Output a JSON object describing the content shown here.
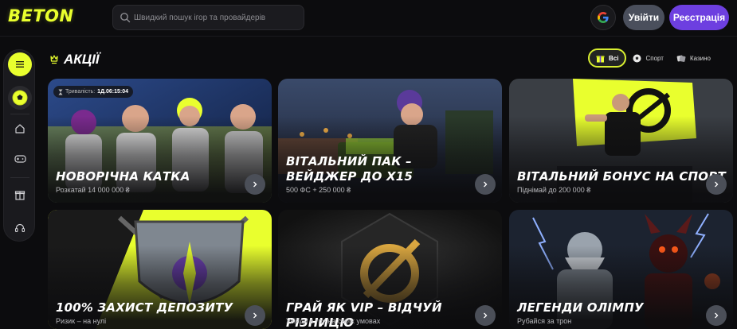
{
  "header": {
    "logo": "BETON",
    "search_placeholder": "Швидкий пошук ігор та провайдерів",
    "login_label": "Увійти",
    "register_label": "Реєстрація"
  },
  "page": {
    "title": "Акції"
  },
  "filters": [
    {
      "label": "Всі",
      "icon": "gift-icon",
      "active": true
    },
    {
      "label": "Спорт",
      "icon": "soccer-ball-icon",
      "active": false
    },
    {
      "label": "Казино",
      "icon": "casino-icon",
      "active": false
    }
  ],
  "sidebar": {
    "items": [
      "menu-icon",
      "soccer-ball-icon",
      "home-icon",
      "gamepad-icon",
      "gift-box-icon",
      "headset-icon"
    ]
  },
  "promos": [
    {
      "title": "Новорічна катка",
      "subtitle": "Розкатай 14 000 000 ₴",
      "timer_label": "Тривалість:",
      "timer_value": "1Д.06:15:04"
    },
    {
      "title": "Вітальний пак – вейджер до х15",
      "subtitle": "500 ФС + 250 000 ₴"
    },
    {
      "title": "Вітальний бонус на спорт",
      "subtitle": "Піднімай до 200 000 ₴"
    },
    {
      "title": "100% захист депозиту",
      "subtitle": "Ризик – на нулі"
    },
    {
      "title": "Грай як VIP – відчуй різницю",
      "subtitle": "Увійди в гру на своїх умовах"
    },
    {
      "title": "Легенди Олімпу",
      "subtitle": "Рубайся за трон"
    }
  ],
  "colors": {
    "accent": "#e9ff2e",
    "register": "#6d3fe0",
    "login": "#4a4f5c",
    "background": "#0c0c0e"
  }
}
